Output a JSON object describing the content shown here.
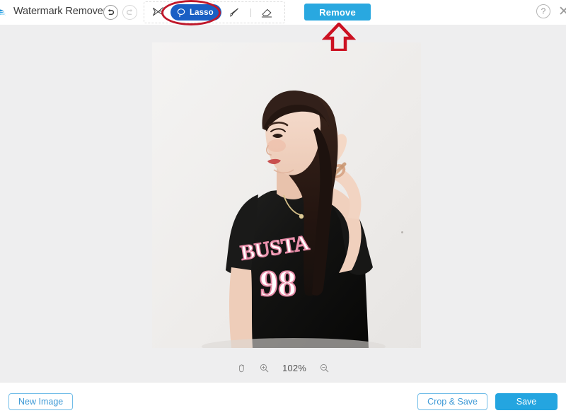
{
  "app": {
    "title": "Watermark Remover",
    "logo_icon": "wave-logo-icon"
  },
  "header": {
    "undo": {
      "icon": "undo-icon",
      "label": "Undo",
      "enabled": true
    },
    "redo": {
      "icon": "redo-icon",
      "label": "Redo",
      "enabled": false
    },
    "tools": [
      {
        "id": "magic-wand",
        "icon": "magic-wand-icon",
        "label": "Magic Wand",
        "selected": false
      },
      {
        "id": "lasso",
        "icon": "lasso-icon",
        "label": "Lasso",
        "selected": true
      },
      {
        "id": "brush",
        "icon": "brush-icon",
        "label": "Brush",
        "selected": false
      },
      {
        "id": "eraser",
        "icon": "eraser-icon",
        "label": "Eraser",
        "selected": false
      }
    ],
    "remove_label": "Remove",
    "help_icon": "question-mark-icon",
    "help_label": "?",
    "close_icon": "close-icon",
    "close_label": "✕"
  },
  "canvas": {
    "image": {
      "alt": "Woman in black t-shirt with BUSTA 98 print, hand raised to hair, light gray studio background",
      "shirt_text_top": "BUSTA",
      "shirt_text_number": "98"
    },
    "zoom": {
      "hand_icon": "hand-tool-icon",
      "zoom_in_icon": "zoom-in-icon",
      "zoom_out_icon": "zoom-out-icon",
      "level": "102%"
    }
  },
  "footer": {
    "new_image_label": "New Image",
    "crop_save_label": "Crop & Save",
    "save_label": "Save"
  },
  "annotations": {
    "ellipse": {
      "name": "red-ellipse-highlight",
      "target": "Lasso",
      "color": "#c0182b"
    },
    "arrow": {
      "name": "red-up-arrow",
      "target": "Remove",
      "color": "#cc1122",
      "direction": "up"
    }
  },
  "colors": {
    "lasso_blue": "#1a5fc4",
    "remove_blue": "#29a8e0",
    "save_blue": "#24a5e0",
    "outline_blue": "#3f9ad6",
    "canvas_bg": "#eeeeef",
    "annotation_red": "#c0182b"
  }
}
